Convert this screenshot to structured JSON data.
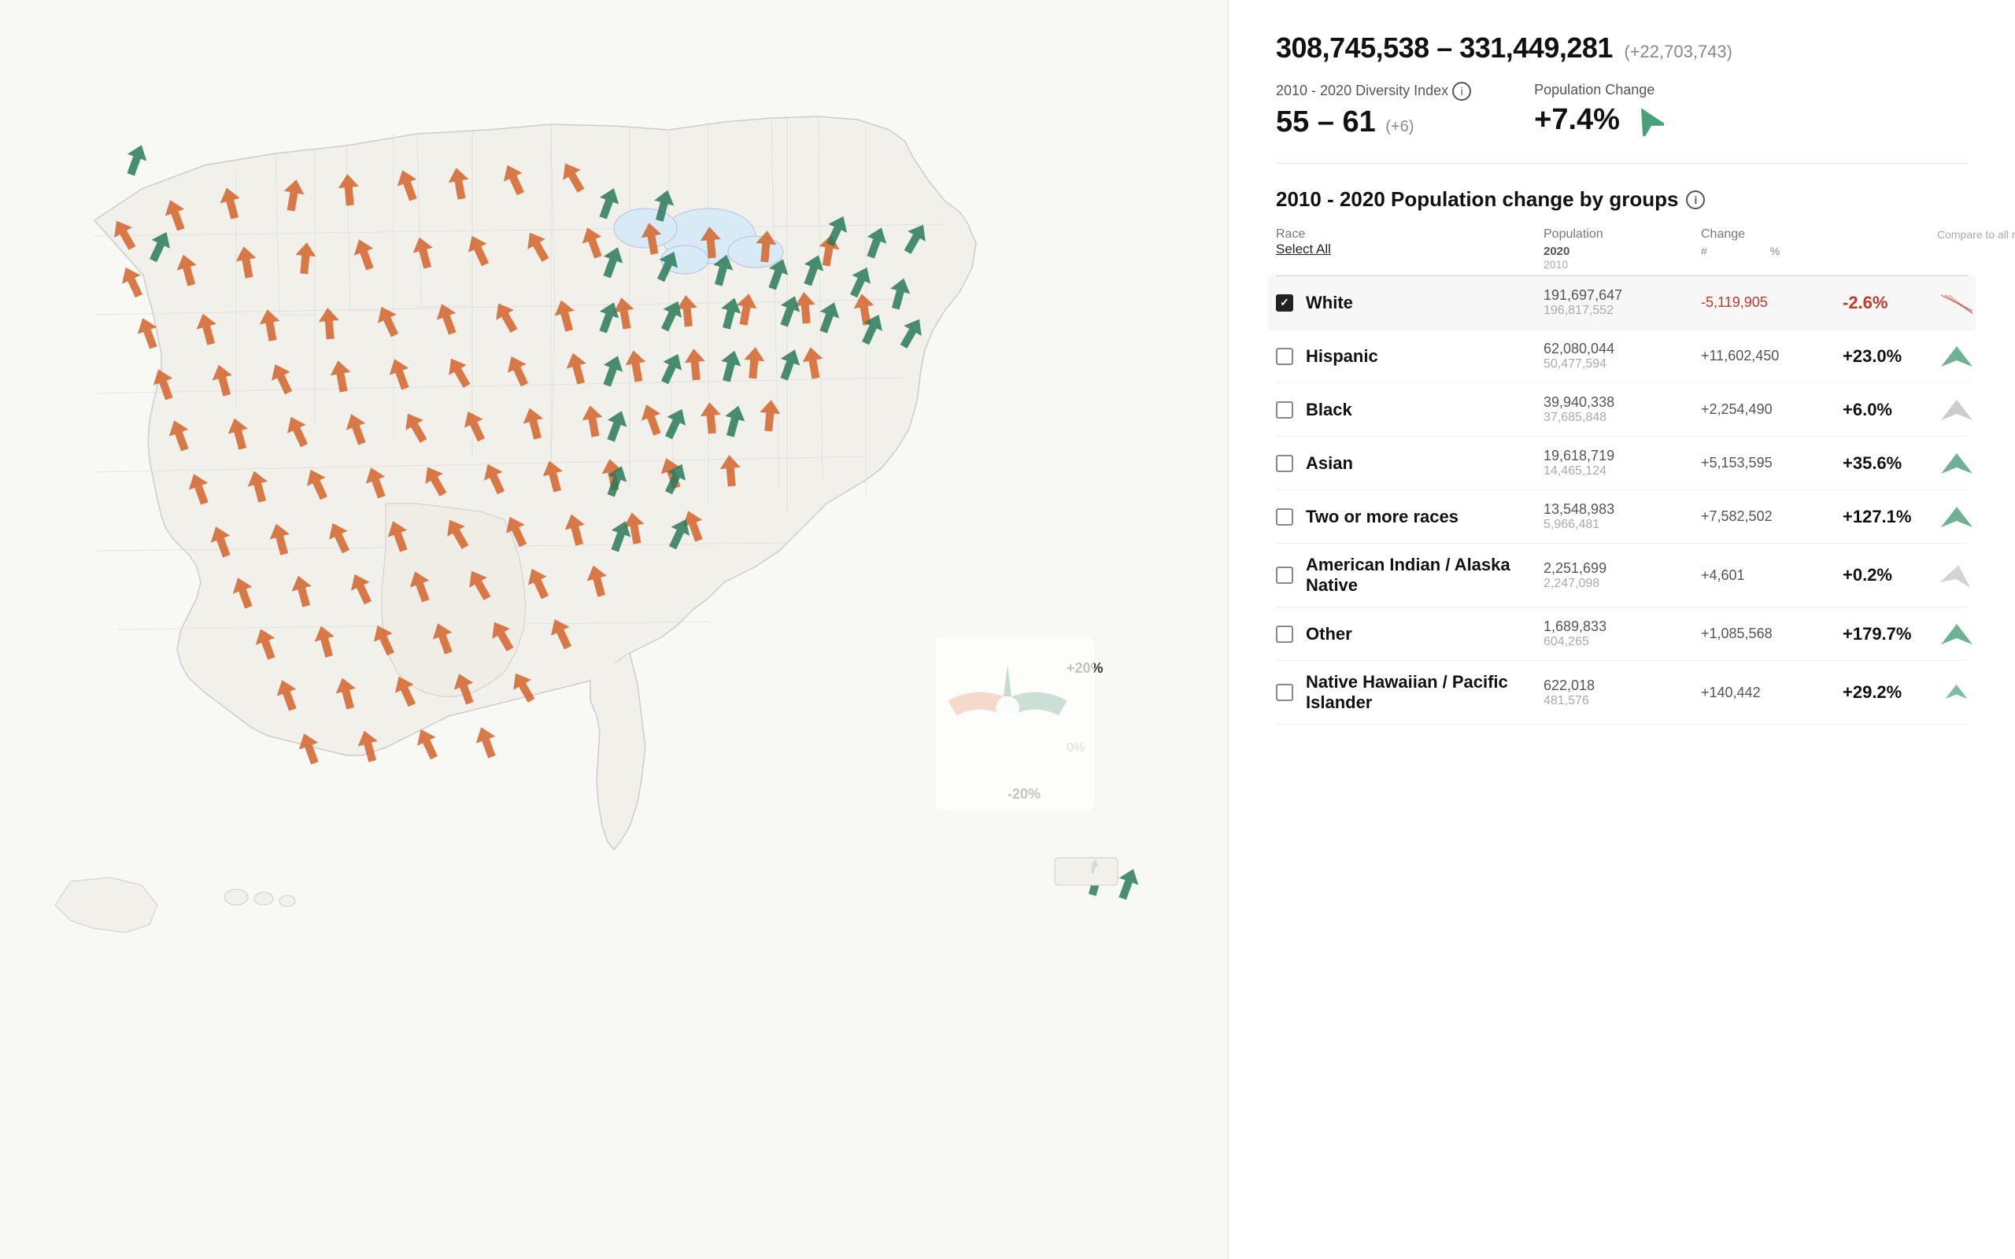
{
  "header": {
    "pop_range": "308,745,538 – 331,449,281",
    "pop_change_inline": "(+22,703,743)",
    "diversity_label": "2010 - 2020 Diversity Index",
    "diversity_range": "55 – 61",
    "diversity_change": "(+6)",
    "pop_change_label": "Population Change",
    "pop_change_value": "+7.4%"
  },
  "table": {
    "section_title": "2010 - 2020 Population change by groups",
    "col_race": "Race",
    "col_population": "Population",
    "col_change": "Change",
    "col_2020": "2020",
    "col_2010": "2010",
    "col_num": "#",
    "col_pct": "%",
    "col_compare": "Compare to all races",
    "select_all": "Select All",
    "rows": [
      {
        "name": "White",
        "checked": true,
        "pop_2020": "191,697,647",
        "pop_2010": "196,817,552",
        "change_num": "-5,119,905",
        "change_pct": "-2.6%",
        "negative": true,
        "compare_dir": "down"
      },
      {
        "name": "Hispanic",
        "checked": false,
        "pop_2020": "62,080,044",
        "pop_2010": "50,477,594",
        "change_num": "+11,602,450",
        "change_pct": "+23.0%",
        "negative": false,
        "compare_dir": "up"
      },
      {
        "name": "Black",
        "checked": false,
        "pop_2020": "39,940,338",
        "pop_2010": "37,685,848",
        "change_num": "+2,254,490",
        "change_pct": "+6.0%",
        "negative": false,
        "compare_dir": "neutral"
      },
      {
        "name": "Asian",
        "checked": false,
        "pop_2020": "19,618,719",
        "pop_2010": "14,465,124",
        "change_num": "+5,153,595",
        "change_pct": "+35.6%",
        "negative": false,
        "compare_dir": "up"
      },
      {
        "name": "Two or more races",
        "checked": false,
        "pop_2020": "13,548,983",
        "pop_2010": "5,966,481",
        "change_num": "+7,582,502",
        "change_pct": "+127.1%",
        "negative": false,
        "compare_dir": "up"
      },
      {
        "name": "American Indian / Alaska Native",
        "checked": false,
        "pop_2020": "2,251,699",
        "pop_2010": "2,247,098",
        "change_num": "+4,601",
        "change_pct": "+0.2%",
        "negative": false,
        "compare_dir": "neutral-down"
      },
      {
        "name": "Other",
        "checked": false,
        "pop_2020": "1,689,833",
        "pop_2010": "604,265",
        "change_num": "+1,085,568",
        "change_pct": "+179.7%",
        "negative": false,
        "compare_dir": "up"
      },
      {
        "name": "Native Hawaiian / Pacific Islander",
        "checked": false,
        "pop_2020": "622,018",
        "pop_2010": "481,576",
        "change_num": "+140,442",
        "change_pct": "+29.2%",
        "negative": false,
        "compare_dir": "up-small"
      }
    ]
  },
  "legend": {
    "plus20": "+20%",
    "zero": "0%",
    "minus20": "-20%"
  }
}
